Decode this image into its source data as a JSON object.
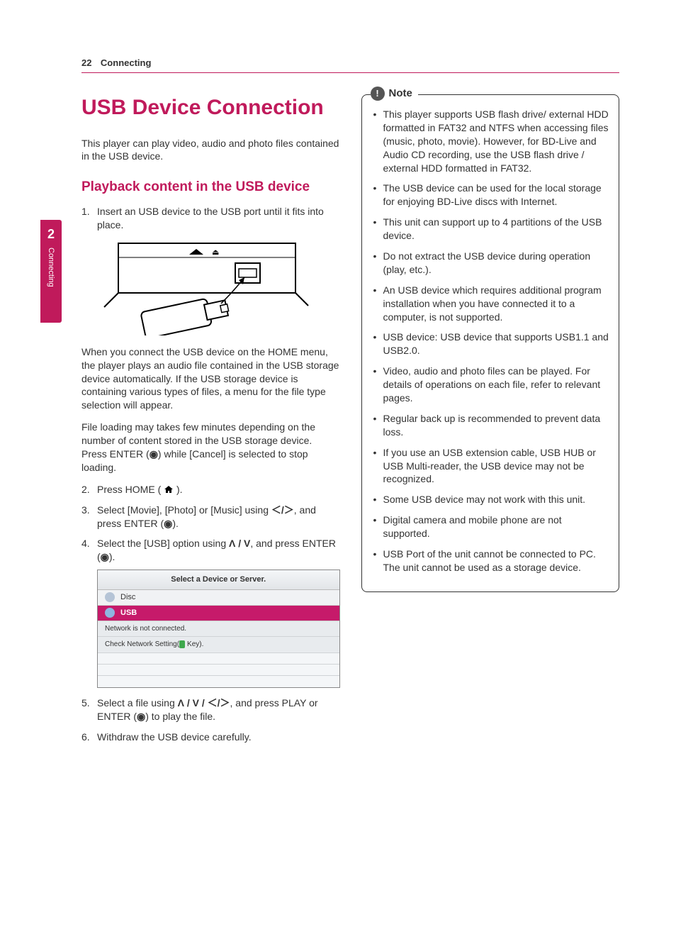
{
  "header": {
    "page_number": "22",
    "section": "Connecting"
  },
  "sidetab": {
    "number": "2",
    "label": "Connecting"
  },
  "left": {
    "h1": "USB Device Connection",
    "intro": "This player can play video, audio and photo files contained in the USB device.",
    "h2": "Playback content in the USB device",
    "step1": "Insert an USB device to the USB port until it fits into place.",
    "para1": "When you connect the USB device on the HOME menu, the player plays an audio file contained in the USB storage device automatically. If the USB storage device is containing various types of files, a menu for the file type selection will appear.",
    "para2_a": "File loading may takes few minutes depending on the number of content stored in the USB storage device. Press ENTER (",
    "para2_b": ") while [Cancel] is selected to stop loading.",
    "step2_a": "Press HOME (",
    "step2_b": ").",
    "step3_a": "Select [Movie], [Photo] or [Music] using ",
    "step3_b": ", and press ENTER (",
    "step3_c": ").",
    "step4_a": "Select the [USB] option using ",
    "step4_b": ", and press ENTER (",
    "step4_c": ").",
    "step5_a": "Select a file using ",
    "step5_b": ", and press PLAY or ENTER (",
    "step5_c": ") to play the file.",
    "step6": "Withdraw the USB device carefully.",
    "screenshot": {
      "title": "Select a Device or Server.",
      "row_disc": "Disc",
      "row_usb": "USB",
      "msg1": "Network is not connected.",
      "msg2_a": "Check Network Setting(",
      "msg2_b": " Key)."
    },
    "symbols": {
      "enter": "◉",
      "home": "⌂",
      "leftright": "＜/＞",
      "updown": "Λ / V",
      "all": "Λ / V / ＜/＞"
    }
  },
  "right": {
    "note_label": "Note",
    "notes": [
      "This player supports USB flash drive/ external HDD formatted in FAT32 and NTFS when accessing files (music, photo, movie). However, for BD-Live and Audio CD recording, use the USB flash drive / external HDD formatted in FAT32.",
      "The USB device can be used for the local storage for enjoying BD-Live discs with Internet.",
      "This unit can support up to 4 partitions of the USB device.",
      "Do not extract the USB device during operation (play, etc.).",
      "An USB device which requires additional program installation when you have connected it to a computer, is not supported.",
      "USB device: USB device that supports USB1.1 and USB2.0.",
      "Video, audio and photo files can be played. For details of operations on each file, refer to relevant pages.",
      "Regular back up is recommended to prevent data loss.",
      "If you use an USB extension cable, USB HUB or USB Multi-reader, the USB device may not be recognized.",
      "Some USB device may not work with this unit.",
      "Digital camera and mobile phone are not supported.",
      "USB Port of the unit cannot be connected to PC. The unit cannot be used as a storage device."
    ]
  }
}
